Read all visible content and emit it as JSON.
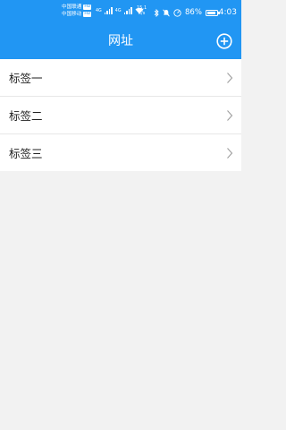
{
  "status_bar": {
    "carrier_1": "中国联通",
    "carrier_2": "中国移动",
    "hd_tag": "HD",
    "signal_labels": [
      "4G",
      "4G"
    ],
    "speed_value": "15.1",
    "speed_unit": "K/s",
    "battery_percent": "86%",
    "battery_level": 0.86,
    "time": "4:03"
  },
  "header": {
    "title": "网址",
    "background_color": "#2196f3",
    "add_icon": "plus-circle-icon"
  },
  "list": {
    "items": [
      {
        "label": "标签一"
      },
      {
        "label": "标签二"
      },
      {
        "label": "标签三"
      }
    ]
  }
}
